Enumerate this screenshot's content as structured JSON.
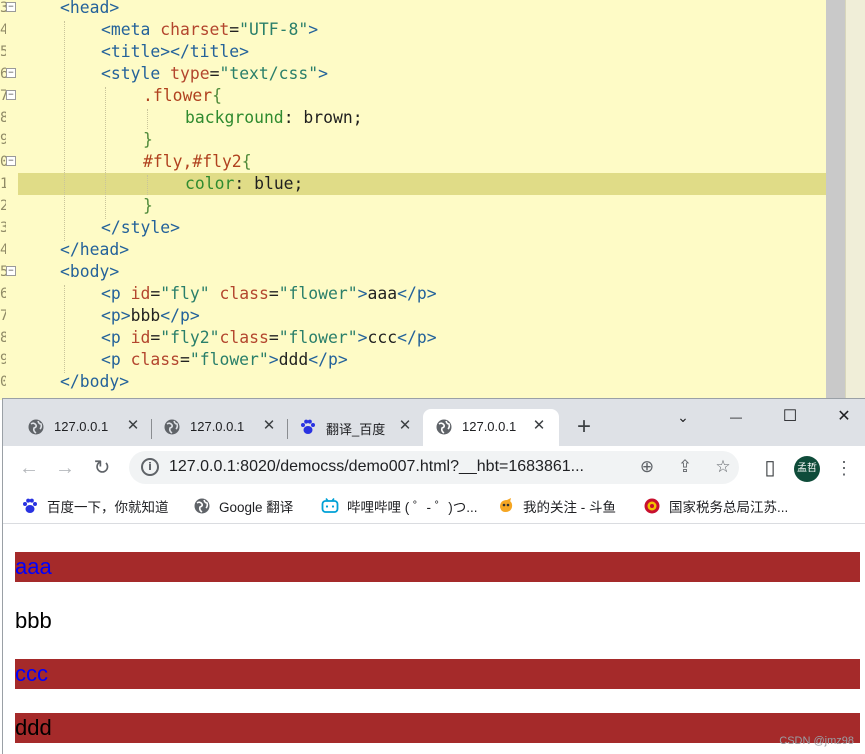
{
  "editor": {
    "line_numbers": [
      "3",
      "4",
      "5",
      "6",
      "7",
      "8",
      "9",
      "0",
      "1",
      "2",
      "3",
      "4",
      "5",
      "6",
      "7",
      "8",
      "9",
      "0"
    ],
    "lines": [
      {
        "text": "<head>"
      },
      {
        "text": "<meta charset=\"UTF-8\">"
      },
      {
        "text": "<title></title>"
      },
      {
        "text": "<style type=\"text/css\">"
      },
      {
        "text": ".flower{"
      },
      {
        "text": "background: brown;"
      },
      {
        "text": "}"
      },
      {
        "text": "#fly,#fly2{"
      },
      {
        "text": "color: blue;"
      },
      {
        "text": "}"
      },
      {
        "text": "</style>"
      },
      {
        "text": "</head>"
      },
      {
        "text": "<body>"
      },
      {
        "text": "<p id=\"fly\" class=\"flower\">aaa</p>"
      },
      {
        "text": "<p>bbb</p>"
      },
      {
        "text": "<p id=\"fly2\"class=\"flower\">ccc</p>"
      },
      {
        "text": "<p class=\"flower\">ddd</p>"
      },
      {
        "text": "</body>"
      }
    ],
    "fold_marker": "−",
    "highlight_color": "#e0dc87",
    "background": "#fefbc6"
  },
  "browser": {
    "tabs": [
      {
        "title": "127.0.0.1",
        "icon": "globe-icon",
        "close": "✕"
      },
      {
        "title": "127.0.0.1",
        "icon": "globe-icon",
        "close": "✕"
      },
      {
        "title": "翻译_百度",
        "icon": "baidu-paw-icon",
        "close": "✕"
      },
      {
        "title": "127.0.0.1",
        "icon": "globe-icon",
        "close": "✕",
        "active": true
      }
    ],
    "new_tab": "+",
    "window_controls": {
      "dropdown": "⌄",
      "minimize": "—",
      "maximize": "☐",
      "close": "✕"
    },
    "nav": {
      "back": "←",
      "forward": "→",
      "reload": "↻"
    },
    "address": "127.0.0.1:8020/democss/demo007.html?__hbt=1683861...",
    "omnibox_info": "i",
    "omnibox_icons": {
      "zoom": "⊕",
      "share": "⇪",
      "star": "☆"
    },
    "side_panel": "▯",
    "avatar_label": "孟哲",
    "menu": "⋮",
    "bookmarks": [
      {
        "label": "百度一下，你就知道",
        "icon": "baidu-paw-icon"
      },
      {
        "label": "Google 翻译",
        "icon": "globe-icon"
      },
      {
        "label": "哔哩哔哩 ( ゜- ゜)つ...",
        "icon": "bilibili-icon"
      },
      {
        "label": "我的关注 - 斗鱼",
        "icon": "douyu-icon"
      },
      {
        "label": "国家税务总局江苏...",
        "icon": "tax-emblem-icon"
      }
    ]
  },
  "page": {
    "paragraphs": [
      {
        "text": "aaa",
        "flower": true,
        "blue": true
      },
      {
        "text": "bbb",
        "flower": false,
        "blue": false
      },
      {
        "text": "ccc",
        "flower": true,
        "blue": true
      },
      {
        "text": "ddd",
        "flower": true,
        "blue": false
      }
    ],
    "flower_color": "brown",
    "highlight_text_color": "blue",
    "watermark": "CSDN @jmz98"
  }
}
